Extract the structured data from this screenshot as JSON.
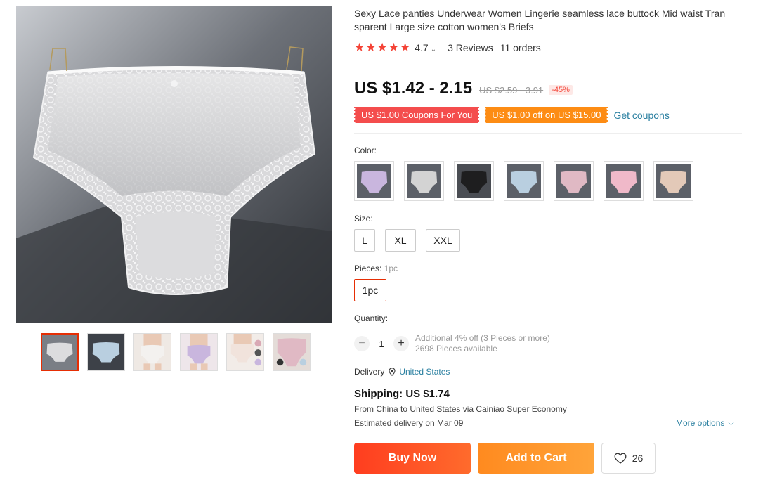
{
  "product": {
    "title": "Sexy Lace panties Underwear Women Lingerie seamless lace buttock Mid waist Transparent Large size cotton women's Briefs",
    "title_line1": "Sexy Lace panties Underwear Women Lingerie seamless lace buttock Mid waist Tran",
    "title_line2": "sparent Large size cotton women's Briefs",
    "rating": "4.7",
    "reviews": "3 Reviews",
    "orders": "11 orders"
  },
  "pricing": {
    "price": "US $1.42 - 2.15",
    "original": "US $2.59 - 3.91",
    "discount": "-45%"
  },
  "coupons": {
    "coupon1": "US $1.00 Coupons For You",
    "coupon2": "US $1.00 off on US $15.00",
    "get_label": "Get coupons"
  },
  "color": {
    "label": "Color:",
    "swatches": [
      {
        "name": "purple",
        "tone": "#c9b6de"
      },
      {
        "name": "grey",
        "tone": "#d3d3d3"
      },
      {
        "name": "black",
        "tone": "#2a2a2a"
      },
      {
        "name": "blue",
        "tone": "#b9cfe0"
      },
      {
        "name": "pink-mauve",
        "tone": "#e0b9c4"
      },
      {
        "name": "pink",
        "tone": "#f0b9c9"
      },
      {
        "name": "beige",
        "tone": "#e3c9b8"
      }
    ]
  },
  "size": {
    "label": "Size:",
    "options": [
      "L",
      "XL",
      "XXL"
    ]
  },
  "pieces": {
    "label": "Pieces:",
    "selected_label": "1pc",
    "option": "1pc"
  },
  "quantity": {
    "label": "Quantity:",
    "value": "1",
    "minus": "−",
    "plus": "+",
    "additional": "Additional 4% off (3 Pieces or more)",
    "available": "2698 Pieces available"
  },
  "delivery": {
    "label": "Delivery",
    "country": "United States"
  },
  "shipping": {
    "title": "Shipping: US $1.74",
    "route": "From China to United States via Cainiao Super Economy",
    "eta": "Estimated delivery on Mar 09",
    "more_options": "More options"
  },
  "actions": {
    "buy_now": "Buy Now",
    "add_to_cart": "Add to Cart",
    "wishlist_count": "26"
  },
  "colors": {
    "accent": "#e62e04",
    "link": "#2b80a1",
    "star": "#f44336"
  }
}
